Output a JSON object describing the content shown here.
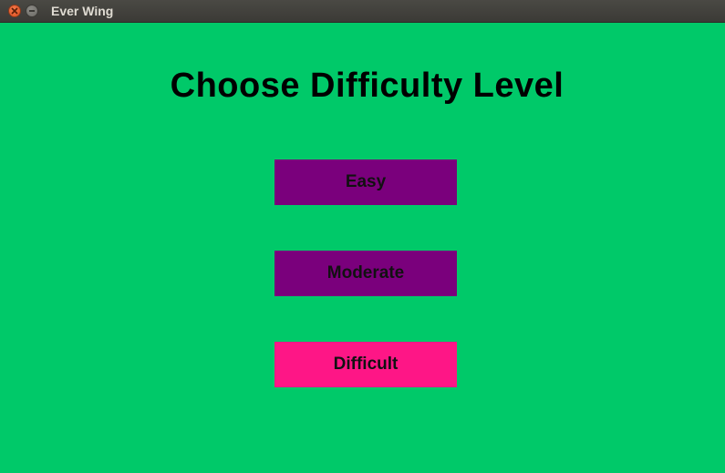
{
  "window": {
    "title": "Ever Wing",
    "close_icon": "close-icon",
    "minimize_icon": "minimize-icon"
  },
  "screen": {
    "heading": "Choose Difficulty Level",
    "background_color": "#00c969"
  },
  "levels": [
    {
      "label": "Easy",
      "color": "#7a007c"
    },
    {
      "label": "Moderate",
      "color": "#7a007c"
    },
    {
      "label": "Difficult",
      "color": "#fe1686"
    }
  ]
}
